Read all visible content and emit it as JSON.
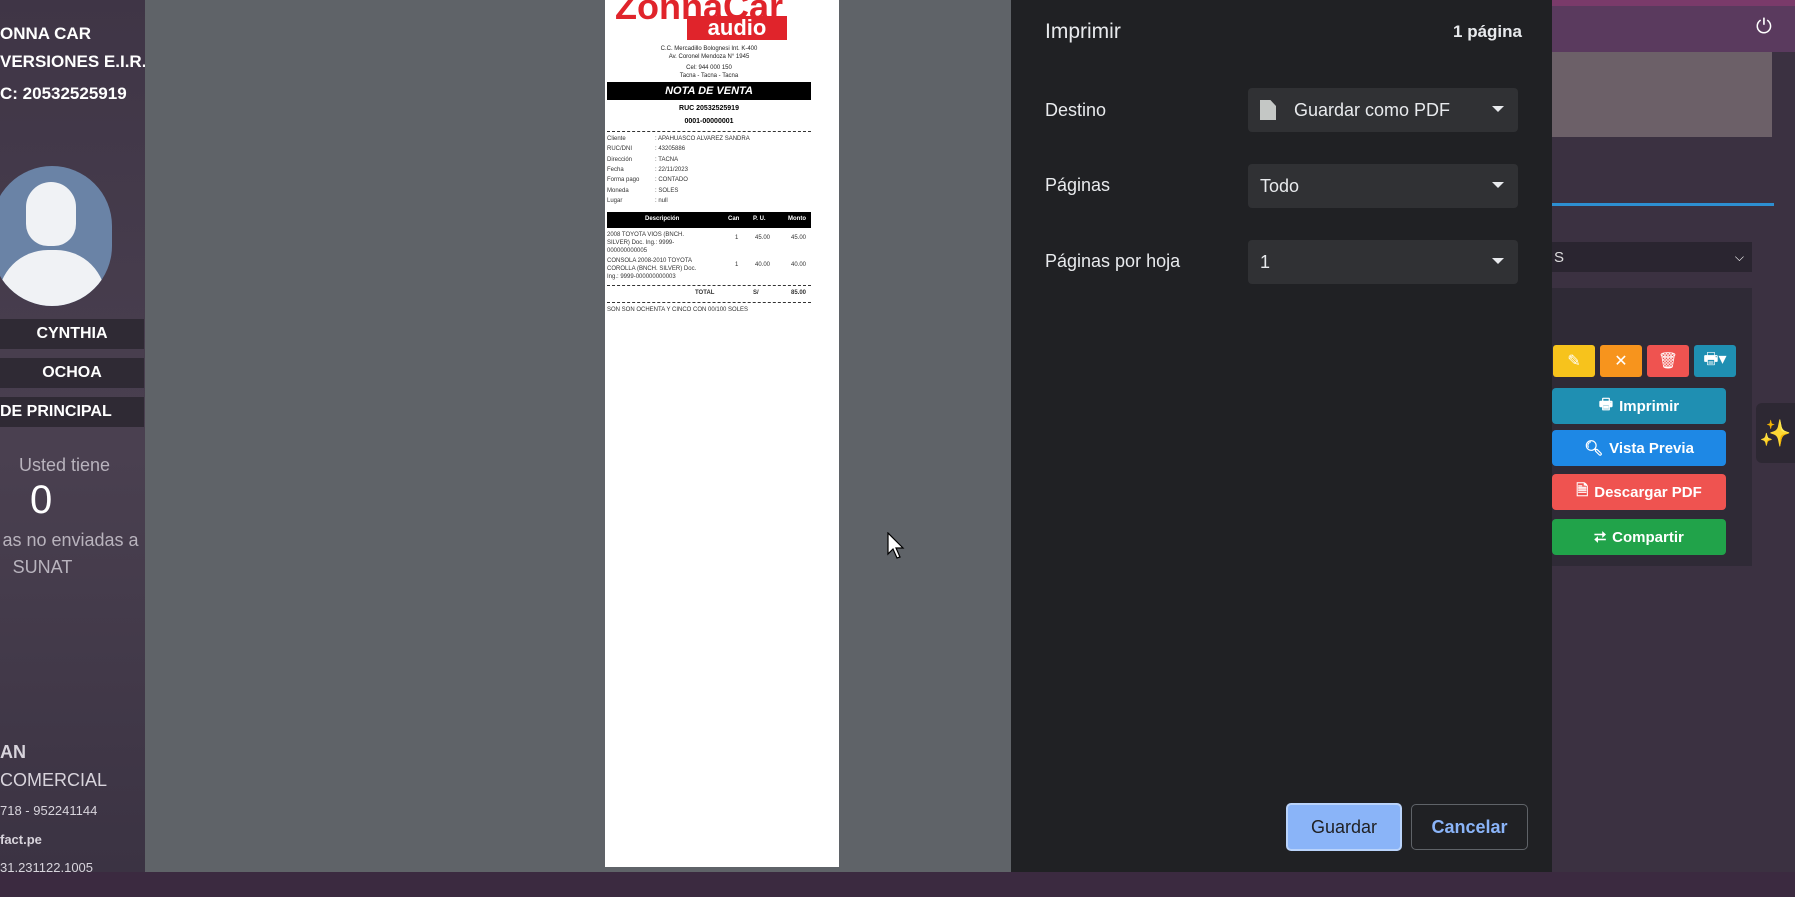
{
  "background_app": {
    "company_lines": [
      "ONNA CAR",
      "VERSIONES E.I.R.",
      "C: 20532525919"
    ],
    "user_first_name": "CYNTHIA",
    "user_last_name": "OCHOA",
    "branch": "DE PRINCIPAL",
    "pending_label_top": "Usted tiene",
    "pending_count": "0",
    "pending_label_mid": "as no enviadas a",
    "pending_label_bottom": "SUNAT",
    "footer_lines": [
      "AN",
      "COMERCIAL",
      "718 - 952241144",
      "fact.pe",
      "31.231122.1005"
    ],
    "right_select_value": "S",
    "menu": {
      "print": "Imprimir",
      "preview": "Vista Previa",
      "download": "Descargar PDF",
      "share": "Compartir"
    },
    "colors": {
      "print": "#1f8fb2",
      "preview": "#1e88e5",
      "download": "#ef5350",
      "share": "#21a34a",
      "edit": "#f7c31c",
      "cancel": "#f7941d",
      "delete": "#ef5350",
      "print_dropdown": "#1f8fb2"
    }
  },
  "receipt": {
    "logo_top": "ZonnaCar",
    "logo_bottom": "audio",
    "address_lines": [
      "C.C. Mercadillo Bolognesi Int. K-400",
      "Av. Coronel Mendoza N° 1945",
      "Cel: 944 000 150",
      "Tacna - Tacna - Tacna"
    ],
    "doc_title": "NOTA DE VENTA",
    "ruc": "RUC 20532525919",
    "number": "0001-00000001",
    "fields": [
      {
        "k": "Cliente",
        "v": ": APAHUASCO ALVAREZ SANDRA"
      },
      {
        "k": "RUC/DNI",
        "v": ": 43205886"
      },
      {
        "k": "Dirección",
        "v": ": TACNA"
      },
      {
        "k": "Fecha",
        "v": ": 22/11/2023"
      },
      {
        "k": "Forma pago",
        "v": ": CONTADO"
      },
      {
        "k": "Moneda",
        "v": ": SOLES"
      },
      {
        "k": "Lugar",
        "v": ": null"
      }
    ],
    "columns": [
      "Descripción",
      "Can",
      "P. U.",
      "Monto"
    ],
    "items": [
      {
        "desc": [
          "2008 TOYOTA VIOS (BNCH.",
          "SILVER) Doc. Ing.: 9999-",
          "000000000005"
        ],
        "qty": "1",
        "pu": "45.00",
        "amount": "45.00"
      },
      {
        "desc": [
          "CONSOLA 2008-2010 TOYOTA",
          "COROLLA (BNCH. SILVER) Doc.",
          "Ing.: 9999-000000000003"
        ],
        "qty": "1",
        "pu": "40.00",
        "amount": "40.00"
      }
    ],
    "total_label": "TOTAL",
    "total_currency": "S/",
    "total_amount": "85.00",
    "amount_words": "SON SON OCHENTA Y CINCO CON 00/100 SOLES"
  },
  "print_dialog": {
    "title": "Imprimir",
    "page_count": "1 página",
    "destination_label": "Destino",
    "destination_value": "Guardar como PDF",
    "pages_label": "Páginas",
    "pages_value": "Todo",
    "per_sheet_label": "Páginas por hoja",
    "per_sheet_value": "1",
    "save_label": "Guardar",
    "cancel_label": "Cancelar"
  }
}
